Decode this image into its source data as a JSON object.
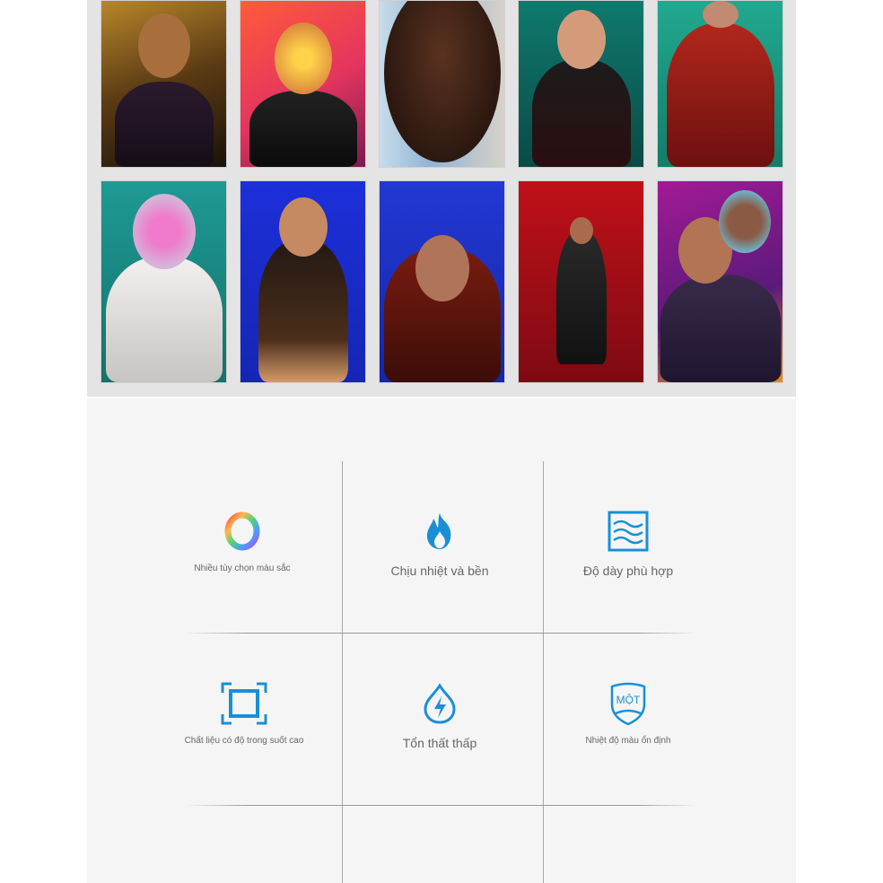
{
  "gallery": {
    "photos": [
      {
        "name": "portrait-1"
      },
      {
        "name": "portrait-2"
      },
      {
        "name": "portrait-3"
      },
      {
        "name": "portrait-4"
      },
      {
        "name": "portrait-5"
      },
      {
        "name": "portrait-6"
      },
      {
        "name": "portrait-7"
      },
      {
        "name": "portrait-8"
      },
      {
        "name": "portrait-9"
      },
      {
        "name": "portrait-10"
      }
    ]
  },
  "features": {
    "accent_color": "#1a8fd6",
    "items": [
      {
        "icon": "rainbow-ring-icon",
        "label": "Nhiều tùy chọn màu sắc"
      },
      {
        "icon": "flame-icon",
        "label": "Chịu nhiệt và bền"
      },
      {
        "icon": "wave-layers-icon",
        "label": "Độ dày phù hợp"
      },
      {
        "icon": "frame-corners-icon",
        "label": "Chất liệu có độ trong suốt cao"
      },
      {
        "icon": "drop-bolt-icon",
        "label": "Tổn thất thấp"
      },
      {
        "icon": "shield-badge-icon",
        "label": "Nhiệt độ màu ổn định",
        "badge_text": "MỘT"
      }
    ]
  }
}
